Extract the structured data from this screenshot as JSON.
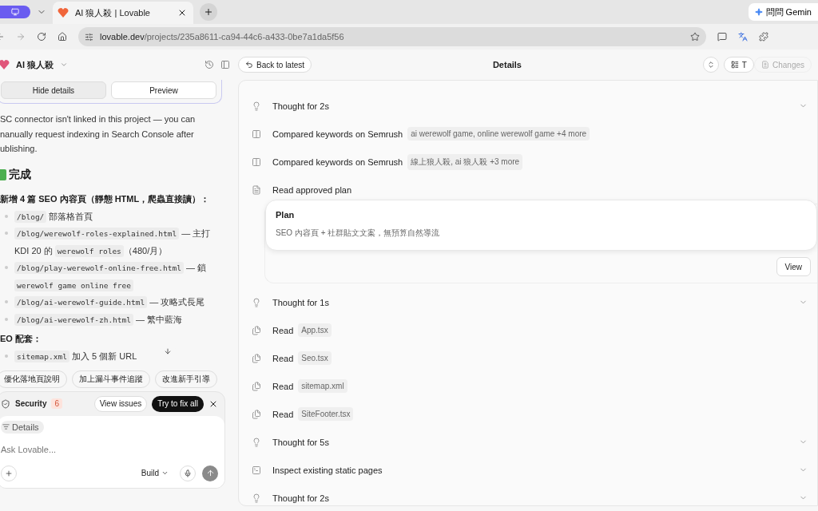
{
  "browser": {
    "tab": {
      "title": "AI 狼人殺 | Lovable"
    },
    "gemini_button": "問問 Gemin",
    "url": {
      "domain": "lovable.dev",
      "path": "/projects/235a8611-ca94-44c6-a433-0be7a1da5f56"
    }
  },
  "header": {
    "project": "AI 狼人殺",
    "back_button": "Back to latest",
    "title": "Details",
    "tabs": [
      {
        "label": "T",
        "disabled": false
      },
      {
        "label": "Changes",
        "disabled": true
      }
    ]
  },
  "chat": {
    "toggle": [
      {
        "label": "Hide details",
        "selected": true
      },
      {
        "label": "Preview",
        "selected": false
      }
    ],
    "paragraph": [
      "SC connector isn't linked in this project — you can",
      "nanually request indexing in Search Console after",
      "ublishing."
    ],
    "heading": "完成",
    "sections": [
      {
        "title": "新增 4 篇 SEO 內容頁（靜態 HTML，爬蟲直接讀）：",
        "items": [
          [
            {
              "kind": "code",
              "text": "/blog/"
            },
            {
              "kind": "text",
              "text": " 部落格首頁"
            }
          ],
          [
            {
              "kind": "code",
              "text": "/blog/werewolf-roles-explained.html"
            },
            {
              "kind": "text",
              "text": " — 主打 KDI 20 的 "
            },
            {
              "kind": "code",
              "text": "werewolf roles"
            },
            {
              "kind": "text",
              "text": "（480/月）"
            }
          ],
          [
            {
              "kind": "code",
              "text": "/blog/play-werewolf-online-free.html"
            },
            {
              "kind": "text",
              "text": " — 鎖 "
            },
            {
              "kind": "code",
              "text": "werewolf game online free"
            }
          ],
          [
            {
              "kind": "code",
              "text": "/blog/ai-werewolf-guide.html"
            },
            {
              "kind": "text",
              "text": " — 攻略式長尾"
            }
          ],
          [
            {
              "kind": "code",
              "text": "/blog/ai-werewolf-zh.html"
            },
            {
              "kind": "text",
              "text": " — 繁中藍海"
            }
          ]
        ]
      },
      {
        "title": "EO 配套：",
        "items": [
          [
            {
              "kind": "code",
              "text": "sitemap.xml"
            },
            {
              "kind": "text",
              "text": " 加入 5 個新 URL"
            }
          ]
        ]
      }
    ],
    "suggestions": [
      "優化落地頁說明",
      "加上漏斗事件追蹤",
      "改進新手引導"
    ],
    "security": {
      "label": "Security",
      "count": "6",
      "view_button": "View issues",
      "fix_button": "Try to fix all"
    },
    "composer": {
      "chip": "Details",
      "placeholder": "Ask Lovable...",
      "mode": "Build"
    }
  },
  "timeline": [
    {
      "kind": "thought",
      "label": "Thought for 2s",
      "expandable": true
    },
    {
      "kind": "keywords",
      "label": "Compared keywords on Semrush",
      "tags": [
        "ai werewolf game, online werewolf game +4 more"
      ],
      "expandable": false
    },
    {
      "kind": "keywords",
      "label": "Compared keywords on Semrush",
      "tags": [
        "線上狼人殺, ai 狼人殺 +3 more"
      ],
      "expandable": false
    },
    {
      "kind": "file",
      "label": "Read approved plan",
      "expandable": false,
      "card": {
        "title": "Plan",
        "text": "SEO 內容頁 + 社群貼文文案，無預算自然導流",
        "button": "View"
      }
    },
    {
      "kind": "thought",
      "label": "Thought for 1s",
      "expandable": true
    },
    {
      "kind": "read",
      "label": "Read",
      "tags": [
        "App.tsx"
      ],
      "expandable": false
    },
    {
      "kind": "read",
      "label": "Read",
      "tags": [
        "Seo.tsx"
      ],
      "expandable": false
    },
    {
      "kind": "read",
      "label": "Read",
      "tags": [
        "sitemap.xml"
      ],
      "expandable": false
    },
    {
      "kind": "read",
      "label": "Read",
      "tags": [
        "SiteFooter.tsx"
      ],
      "expandable": false
    },
    {
      "kind": "thought",
      "label": "Thought for 5s",
      "expandable": true
    },
    {
      "kind": "command",
      "label": "Inspect existing static pages",
      "expandable": true
    },
    {
      "kind": "thought",
      "label": "Thought for 2s",
      "expandable": true
    }
  ]
}
